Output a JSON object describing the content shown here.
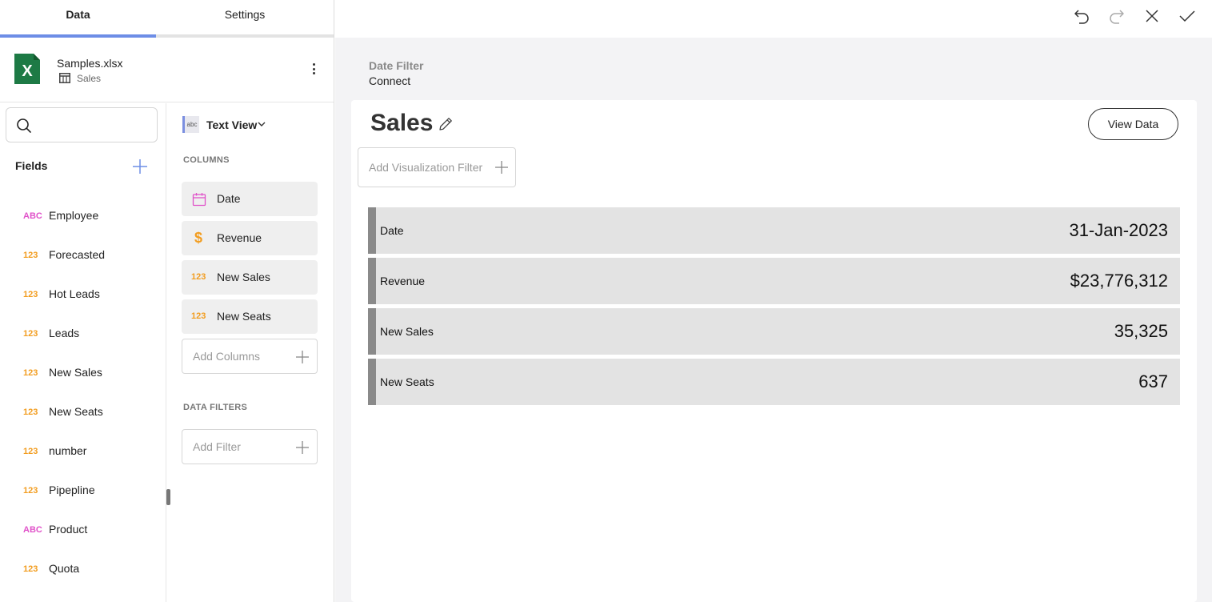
{
  "tabs": {
    "data": "Data",
    "settings": "Settings"
  },
  "source": {
    "file_name": "Samples.xlsx",
    "sheet_name": "Sales",
    "icon": "excel-icon"
  },
  "fields": {
    "title": "Fields",
    "items": [
      {
        "type": "ABC",
        "label": "Employee"
      },
      {
        "type": "123",
        "label": "Forecasted"
      },
      {
        "type": "123",
        "label": "Hot Leads"
      },
      {
        "type": "123",
        "label": "Leads"
      },
      {
        "type": "123",
        "label": "New Sales"
      },
      {
        "type": "123",
        "label": "New Seats"
      },
      {
        "type": "123",
        "label": "number"
      },
      {
        "type": "123",
        "label": "Pipepline"
      },
      {
        "type": "ABC",
        "label": "Product"
      },
      {
        "type": "123",
        "label": "Quota"
      }
    ]
  },
  "config": {
    "view_type_icon": "abc",
    "view_type": "Text View",
    "columns_label": "COLUMNS",
    "columns": [
      {
        "icon": "calendar-icon",
        "label": "Date"
      },
      {
        "icon": "dollar-icon",
        "label": "Revenue"
      },
      {
        "icon": "123",
        "label": "New Sales"
      },
      {
        "icon": "123",
        "label": "New Seats"
      }
    ],
    "add_columns": "Add Columns",
    "data_filters_label": "DATA FILTERS",
    "add_filter": "Add Filter"
  },
  "dashboard_filter": {
    "title": "Date Filter",
    "value": "Connect"
  },
  "visualization": {
    "title": "Sales",
    "view_data": "View Data",
    "add_filter": "Add Visualization Filter",
    "rows": [
      {
        "label": "Date",
        "value": "31-Jan-2023"
      },
      {
        "label": "Revenue",
        "value": "$23,776,312"
      },
      {
        "label": "New Sales",
        "value": "35,325"
      },
      {
        "label": "New Seats",
        "value": "637"
      }
    ]
  },
  "colors": {
    "accent": "#6d8de6",
    "string_type": "#e052c9",
    "number_type": "#f29d20",
    "kpi_bar": "#8a8a8a",
    "kpi_bg": "#e3e3e3"
  }
}
